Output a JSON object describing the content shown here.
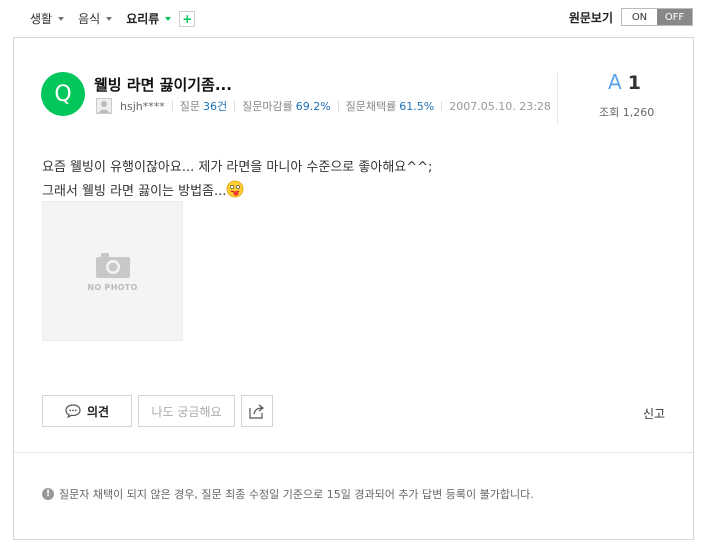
{
  "breadcrumb": {
    "items": [
      {
        "label": "생활",
        "active": false
      },
      {
        "label": "음식",
        "active": false
      },
      {
        "label": "요리류",
        "active": true
      }
    ],
    "add_label": "+"
  },
  "original_view": {
    "label": "원문보기",
    "on_label": "ON",
    "off_label": "OFF",
    "selected": "OFF"
  },
  "question": {
    "avatar_letter": "Q",
    "title": "웰빙 라면 끓이기좀...",
    "author": "hsjh****",
    "question_label": "질문",
    "question_count": "36건",
    "close_rate_label": "질문마감률",
    "close_rate": "69.2%",
    "adopt_rate_label": "질문채택률",
    "adopt_rate": "61.5%",
    "date": "2007.05.10. 23:28",
    "body_line1": "요즘 웰빙이 유행이잖아요...   제가 라면을 마니아 수준으로 좋아해요^^;",
    "body_line2": "그래서 웰빙 라면 끓이는 방법좀...",
    "no_photo_label": "NO PHOTO"
  },
  "stats": {
    "answer_prefix": "A",
    "answer_count": "1",
    "views_label": "조회",
    "views": "1,260"
  },
  "actions": {
    "opinion_label": "의견",
    "curious_label": "나도 궁금해요",
    "report_label": "신고"
  },
  "notice": {
    "text": "질문자 채택이 되지 않은 경우, 질문 최종 수정일 기준으로 15일 경과되어 추가 답변 등록이 불가합니다."
  },
  "colors": {
    "brand": "#03c75a",
    "link": "#1c6fb8",
    "answer_accent": "#5ba3e6"
  }
}
